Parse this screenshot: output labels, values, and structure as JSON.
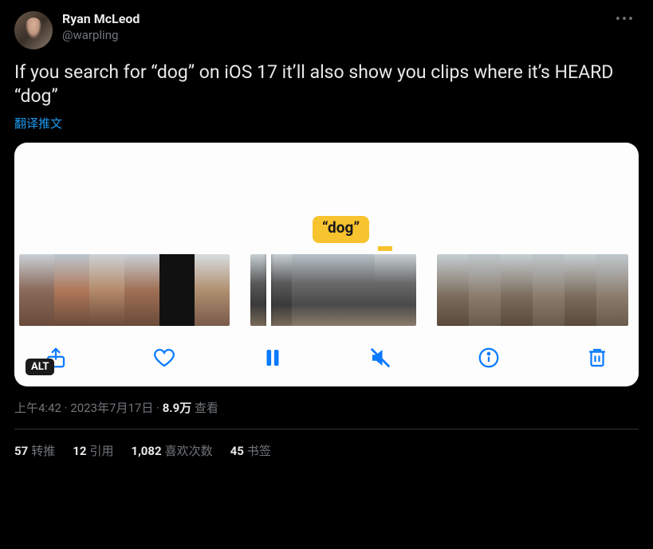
{
  "author": {
    "display_name": "Ryan McLeod",
    "handle": "@warpling"
  },
  "tweet_text": "If you search for “dog” on iOS 17 it’ll also show you clips where it’s HEARD “dog”",
  "translate_label": "翻译推文",
  "media": {
    "caption_badge": "“dog”",
    "alt_badge": "ALT"
  },
  "meta": {
    "time": "上午4:42",
    "sep1": " · ",
    "date": "2023年7月17日",
    "sep2": " · ",
    "views_number": "8.9万",
    "views_label": " 查看"
  },
  "stats": {
    "retweets_num": "57",
    "retweets_label": "转推",
    "quotes_num": "12",
    "quotes_label": "引用",
    "likes_num": "1,082",
    "likes_label": "喜欢次数",
    "bookmarks_num": "45",
    "bookmarks_label": "书签"
  }
}
